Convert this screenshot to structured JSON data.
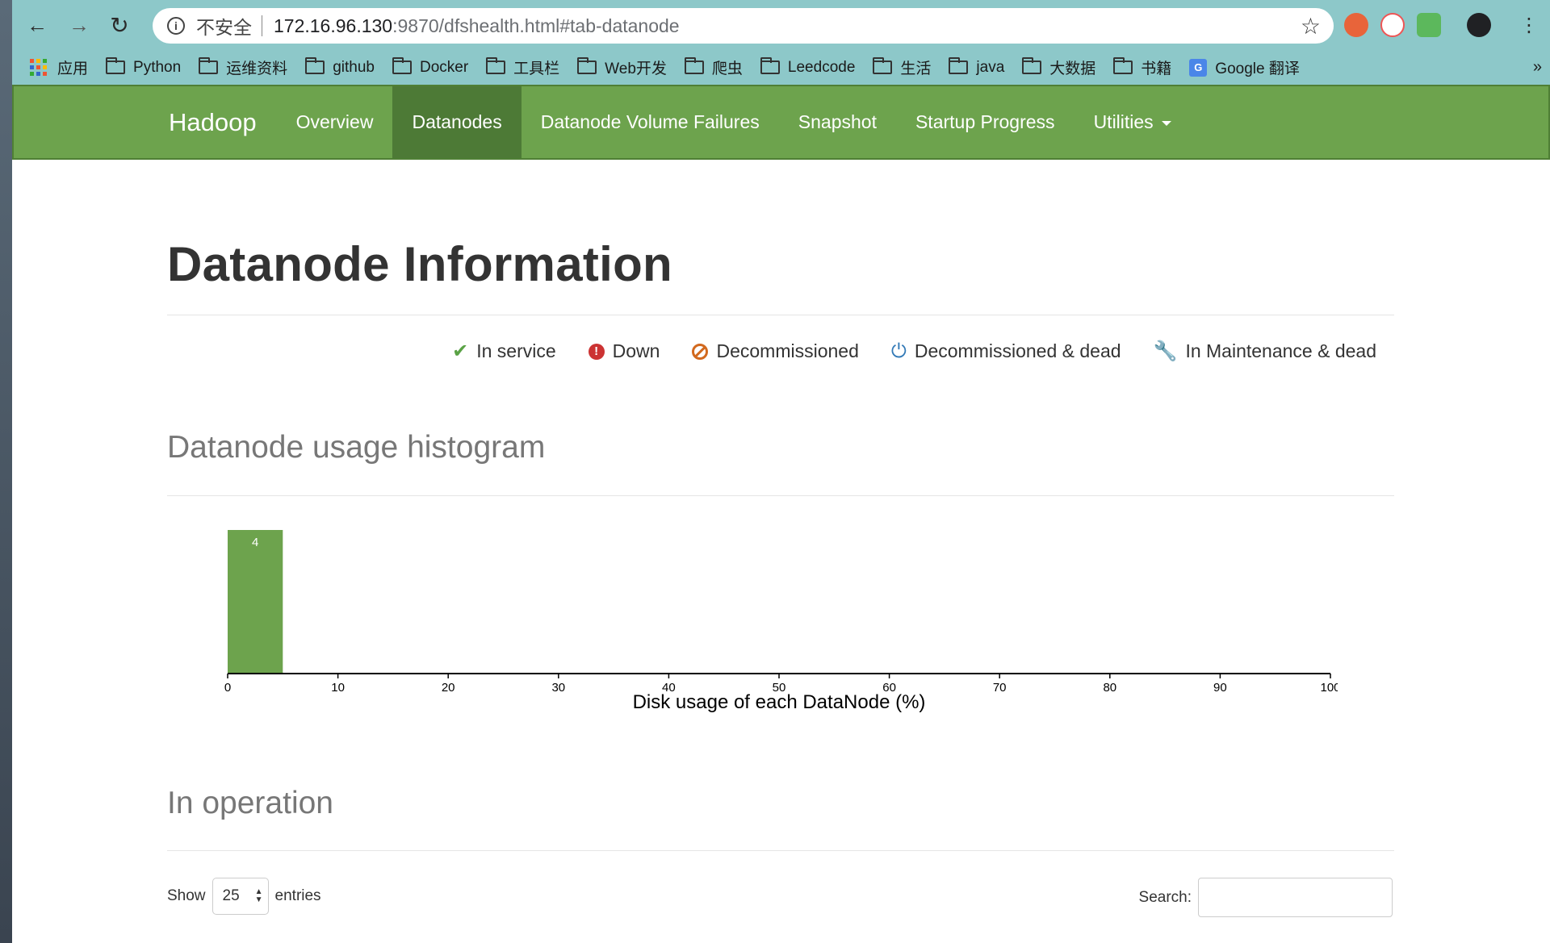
{
  "browser": {
    "insecure_label": "不安全",
    "url_host": "172.16.96.130",
    "url_rest": ":9870/dfshealth.html#tab-datanode",
    "bookmarks": [
      "应用",
      "Python",
      "运维资料",
      "github",
      "Docker",
      "工具栏",
      "Web开发",
      "爬虫",
      "Leedcode",
      "生活",
      "java",
      "大数据",
      "书籍",
      "Google 翻译"
    ],
    "more": "»"
  },
  "navbar": {
    "brand": "Hadoop",
    "items": [
      "Overview",
      "Datanodes",
      "Datanode Volume Failures",
      "Snapshot",
      "Startup Progress",
      "Utilities"
    ],
    "active": "Datanodes"
  },
  "page": {
    "title": "Datanode Information",
    "legend": [
      "In service",
      "Down",
      "Decommissioned",
      "Decommissioned & dead",
      "In Maintenance & dead"
    ],
    "histogram_heading": "Datanode usage histogram",
    "operation_heading": "In operation",
    "show_label": "Show",
    "entries_value": "25",
    "entries_label": "entries",
    "search_label": "Search:"
  },
  "chart_data": {
    "type": "bar",
    "xlabel": "Disk usage of each DataNode (%)",
    "xlim": [
      0,
      100
    ],
    "xticks": [
      0,
      10,
      20,
      30,
      40,
      50,
      60,
      70,
      80,
      90,
      100
    ],
    "bins": [
      {
        "x0": 0,
        "x1": 5,
        "count": 4
      }
    ],
    "bar_color": "#6da34d"
  },
  "colors": {
    "navbar": "#6da34d",
    "navbar_active": "#4d7a36",
    "chrome": "#8dc8c9"
  }
}
